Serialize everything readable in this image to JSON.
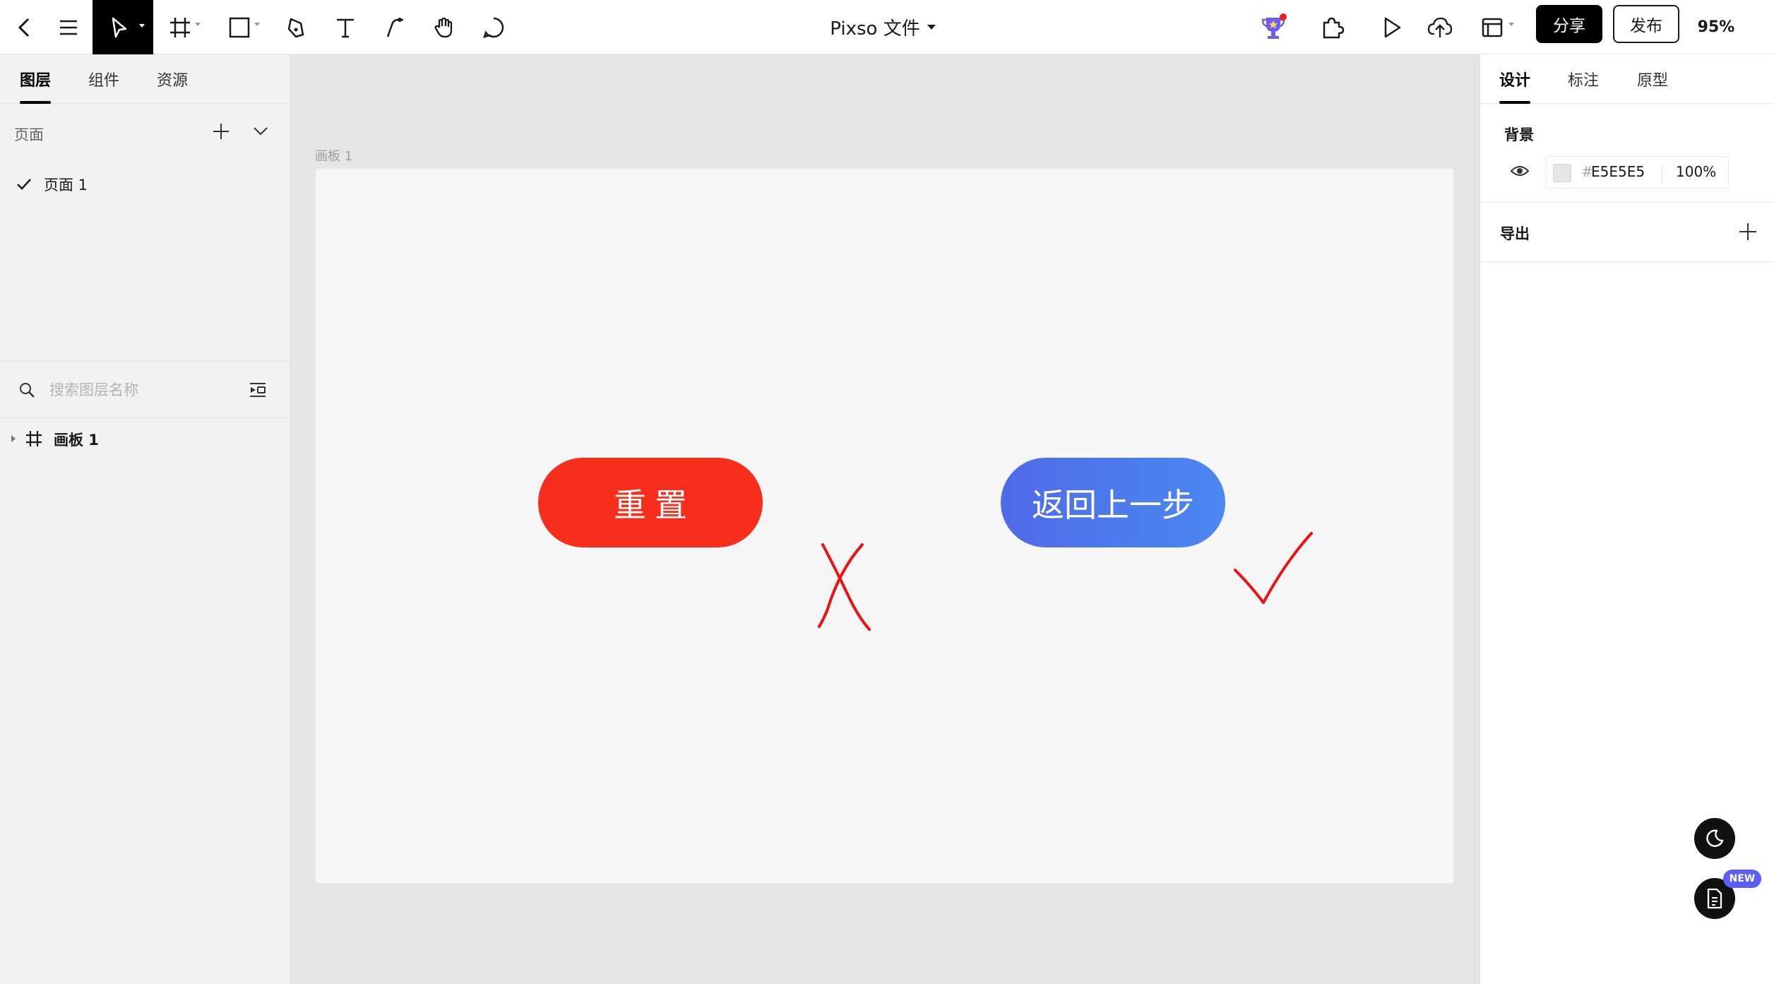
{
  "toolbar": {
    "file_title": "Pixso 文件",
    "share_label": "分享",
    "publish_label": "发布",
    "zoom": "95%",
    "icons": [
      "back-icon",
      "menu-icon",
      "move-tool-icon",
      "frame-tool-icon",
      "rectangle-tool-icon",
      "pen-tool-icon",
      "text-tool-icon",
      "connector-tool-icon",
      "hand-tool-icon",
      "comment-tool-icon",
      "trophy-icon",
      "plugin-icon",
      "play-icon",
      "upload-icon",
      "layout-icon"
    ]
  },
  "left_panel": {
    "tabs": [
      {
        "label": "图层",
        "active": true
      },
      {
        "label": "组件",
        "active": false
      },
      {
        "label": "资源",
        "active": false
      }
    ],
    "pages_header": "页面",
    "pages": [
      {
        "label": "页面 1",
        "selected": true
      }
    ],
    "search_placeholder": "搜索图层名称",
    "layers": [
      {
        "label": "画板 1",
        "type": "frame"
      }
    ]
  },
  "canvas": {
    "artboard_label": "画板 1",
    "artboard_color": "#F6F6F6",
    "reset_button": {
      "label": "重置",
      "color": "#F82E1D"
    },
    "back_button": {
      "label": "返回上一步",
      "gradient": [
        "#4F6BE8",
        "#4B88F0"
      ]
    },
    "marks": [
      {
        "type": "cross",
        "color": "#EE1111"
      },
      {
        "type": "check",
        "color": "#EE1111"
      }
    ]
  },
  "right_panel": {
    "tabs": [
      {
        "label": "设计",
        "active": true
      },
      {
        "label": "标注",
        "active": false
      },
      {
        "label": "原型",
        "active": false
      }
    ],
    "background_title": "背景",
    "background_hash": "#",
    "background_hex": "E5E5E5",
    "background_opacity": "100%",
    "background_swatch": "#E5E5E5",
    "export_title": "导出"
  },
  "floating": {
    "new_badge": "NEW"
  }
}
